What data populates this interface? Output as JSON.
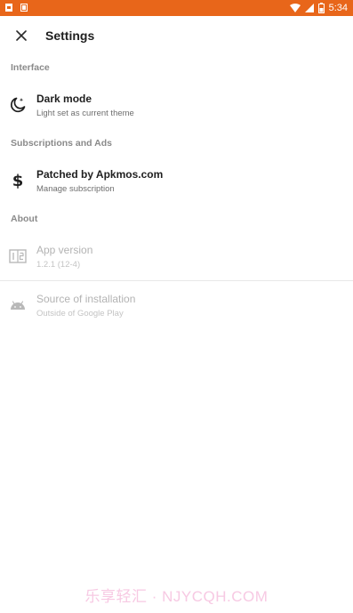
{
  "status_bar": {
    "time": "5:34",
    "icons": [
      "notification-icon",
      "download-icon",
      "wifi-icon",
      "signal-icon",
      "battery-icon"
    ],
    "background_color": "#e8661a"
  },
  "toolbar": {
    "title": "Settings",
    "close_icon": "close-icon"
  },
  "sections": {
    "interface": {
      "header": "Interface",
      "items": [
        {
          "title": "Dark mode",
          "subtitle": "Light set as current theme",
          "icon": "moon-icon"
        }
      ]
    },
    "subscriptions": {
      "header": "Subscriptions and Ads",
      "items": [
        {
          "title": "Patched by Apkmos.com",
          "subtitle": "Manage subscription",
          "icon": "dollar-icon"
        }
      ]
    },
    "about": {
      "header": "About",
      "items": [
        {
          "title": "App version",
          "subtitle": "1.2.1 (12-4)",
          "icon": "version-icon"
        },
        {
          "title": "Source of installation",
          "subtitle": "Outside of Google Play",
          "icon": "android-icon"
        }
      ]
    }
  },
  "watermark": "乐享轻汇 · NJYCQH.COM"
}
